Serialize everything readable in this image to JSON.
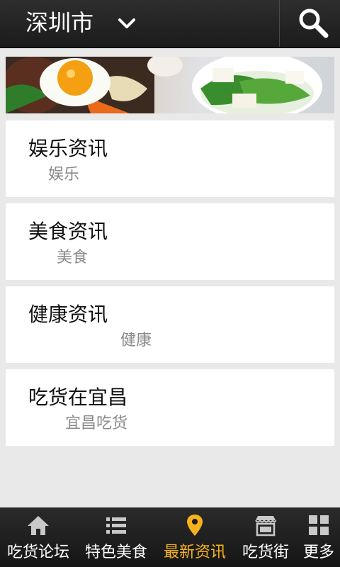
{
  "header": {
    "city": "深圳市"
  },
  "categories": [
    {
      "title": "娱乐资讯",
      "subtitle": "娱乐"
    },
    {
      "title": "美食资讯",
      "subtitle": "美食"
    },
    {
      "title": "健康资讯",
      "subtitle": "健康"
    },
    {
      "title": "吃货在宜昌",
      "subtitle": "宜昌吃货"
    }
  ],
  "tabbar": {
    "active_color": "#f7b21c",
    "items": [
      {
        "label": "吃货论坛",
        "icon": "home-icon"
      },
      {
        "label": "特色美食",
        "icon": "list-icon"
      },
      {
        "label": "最新资讯",
        "icon": "location-pin-icon",
        "active": true
      },
      {
        "label": "吃货街",
        "icon": "storefront-icon"
      },
      {
        "label": "更多",
        "icon": "grid-icon"
      }
    ]
  }
}
